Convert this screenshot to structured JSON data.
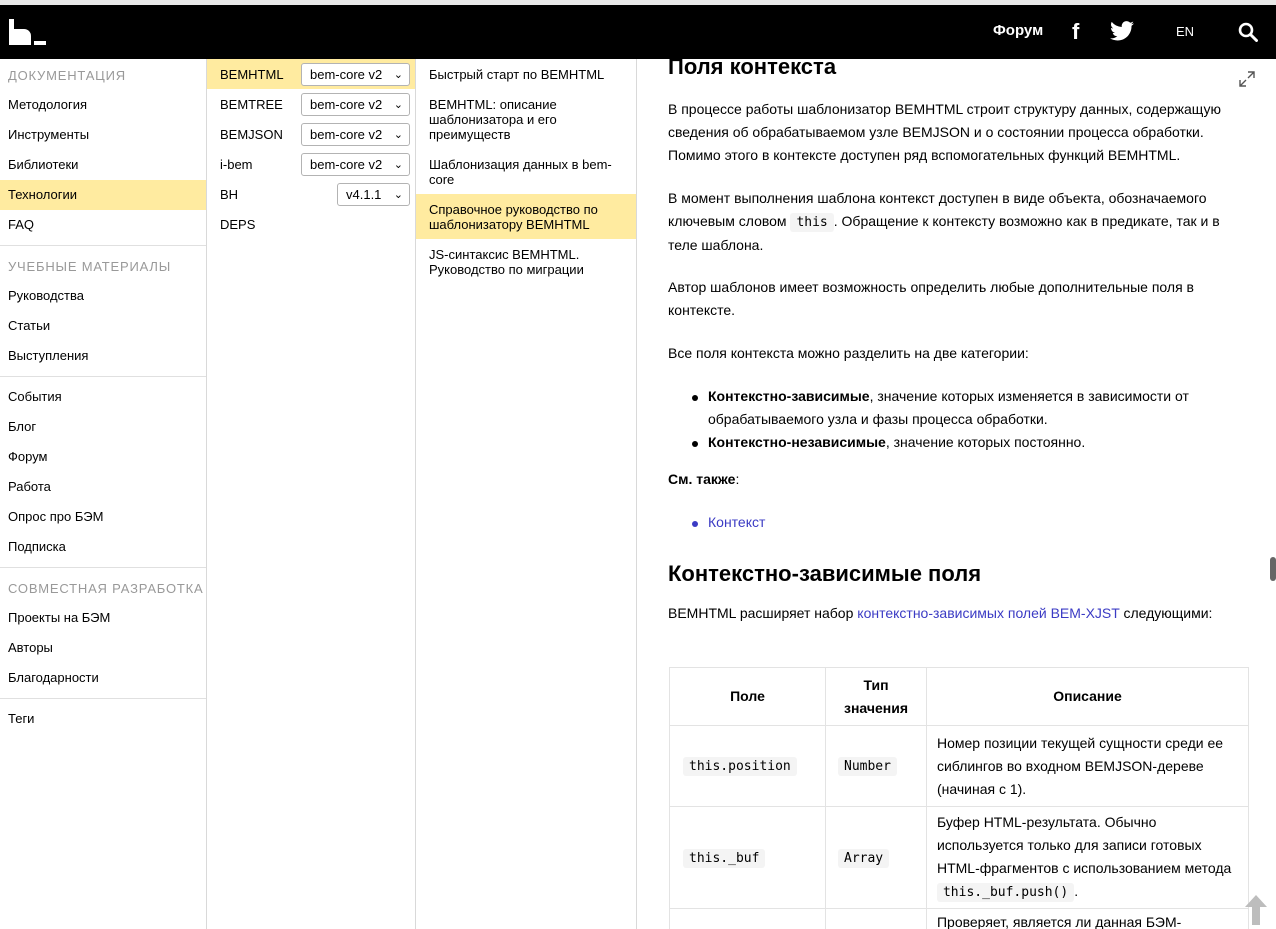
{
  "header": {
    "forum_label": "Форум",
    "fb_label": "f",
    "lang_label": "EN"
  },
  "sidebar": {
    "sections": [
      {
        "title": "ДОКУМЕНТАЦИЯ",
        "items": [
          "Методология",
          "Инструменты",
          "Библиотеки",
          "Технологии",
          "FAQ"
        ]
      },
      {
        "title": "УЧЕБНЫЕ МАТЕРИАЛЫ",
        "items": [
          "Руководства",
          "Статьи",
          "Выступления"
        ]
      },
      {
        "title": "",
        "items": [
          "События",
          "Блог",
          "Форум",
          "Работа",
          "Опрос про БЭМ",
          "Подписка"
        ]
      },
      {
        "title": "СОВМЕСТНАЯ РАЗРАБОТКА",
        "items": [
          "Проекты на БЭМ",
          "Авторы",
          "Благодарности"
        ]
      },
      {
        "title": "",
        "items": [
          "Теги"
        ]
      }
    ],
    "active_item": "Технологии"
  },
  "technologies": [
    {
      "name": "BEMHTML",
      "version": "bem-core v2"
    },
    {
      "name": "BEMTREE",
      "version": "bem-core v2"
    },
    {
      "name": "BEMJSON",
      "version": "bem-core v2"
    },
    {
      "name": "i-bem",
      "version": "bem-core v2"
    },
    {
      "name": "BH",
      "version": "v4.1.1"
    },
    {
      "name": "DEPS",
      "version": ""
    }
  ],
  "docs": [
    "Быстрый старт по BEMHTML",
    "BEMHTML: описание шаблонизатора и его преимуществ",
    "Шаблонизация данных в bem-core",
    "Справочное руководство по шаблонизатору BEMHTML",
    "JS-синтаксис BEMHTML. Руководство по миграции"
  ],
  "content": {
    "h1": "Поля контекста",
    "p1": "В процессе работы шаблонизатор BEMHTML строит структуру данных, содержащую сведения об обрабатываемом узле BEMJSON и о состоянии процесса обработки. Помимо этого в контексте доступен ряд вспомогательных функций BEMHTML.",
    "p2_a": "В момент выполнения шаблона контекст доступен в виде объекта, обозначаемого ключевым словом ",
    "p2_code": "this",
    "p2_b": ". Обращение к контексту возможно как в предикате, так и в теле шаблона.",
    "p3": "Автор шаблонов имеет возможность определить любые дополнительные поля в контексте.",
    "p4": "Все поля контекста можно разделить на две категории:",
    "li1_bold": "Контекстно-зависимые",
    "li1_rest": ", значение которых изменяется в зависимости от обрабатываемого узла и фазы процесса обработки.",
    "li2_bold": "Контекстно-независимые",
    "li2_rest": ", значение которых постоянно.",
    "see_also": "См. также",
    "see_also_colon": ":",
    "see_link": "Контекст",
    "h2": "Контекстно-зависимые поля",
    "p5_a": "BEMHTML расширяет набор ",
    "p5_link": "контекстно-зависимых полей BEM-XJST",
    "p5_b": " следующими:",
    "table": {
      "headers": [
        "Поле",
        "Тип значения",
        "Описание"
      ],
      "rows": [
        {
          "field": "this.position",
          "type": "Number",
          "desc": "Номер позиции текущей сущности среди ее сиблингов во входном BEMJSON-дереве (начиная с 1)."
        },
        {
          "field": "this._buf",
          "type": "Array",
          "desc_a": "Буфер HTML-результата. Обычно используется только для записи готовых HTML-фрагментов с использованием метода ",
          "desc_code": "this._buf.push()",
          "desc_b": "."
        },
        {
          "field": "",
          "type": "",
          "desc": "Проверяет, является ли данная БЭМ-"
        }
      ]
    }
  }
}
